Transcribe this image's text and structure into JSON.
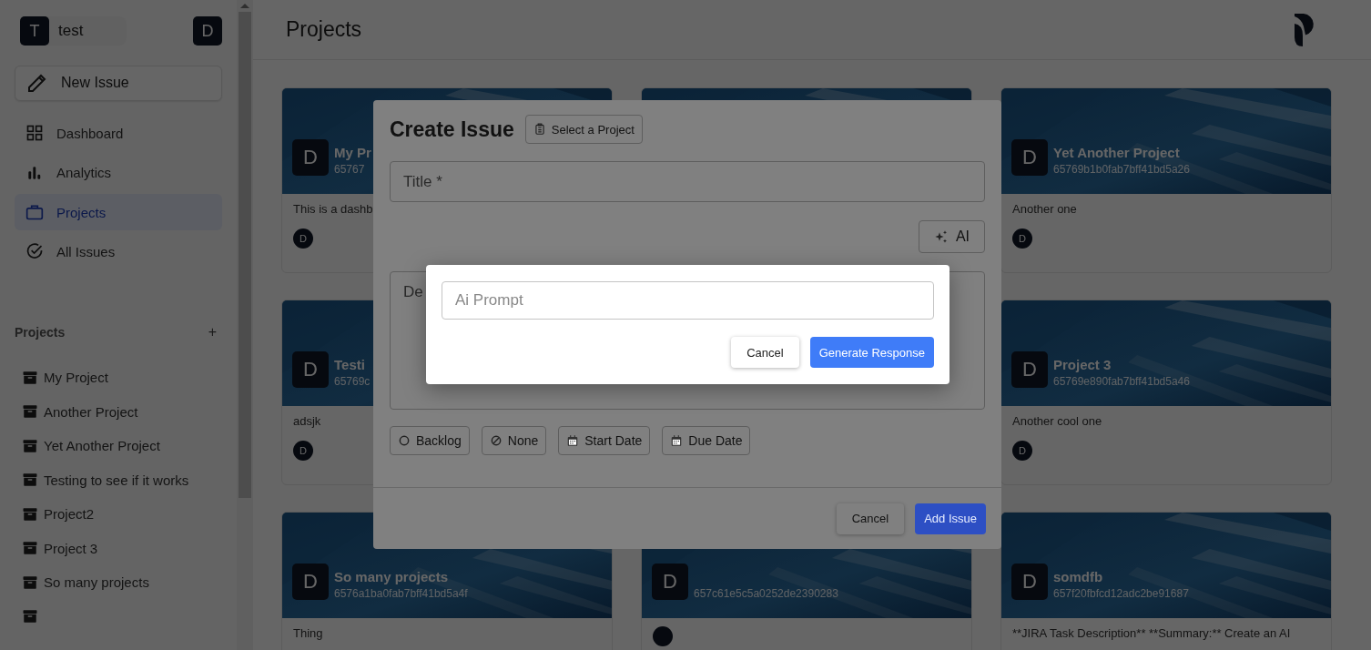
{
  "sidebar": {
    "workspace": {
      "initial": "T",
      "name": "test"
    },
    "user_avatar": "D",
    "new_issue": "New Issue",
    "nav": [
      {
        "label": "Dashboard",
        "selected": false
      },
      {
        "label": "Analytics",
        "selected": false
      },
      {
        "label": "Projects",
        "selected": true
      },
      {
        "label": "All Issues",
        "selected": false
      }
    ],
    "projects_heading": "Projects",
    "add_project": "+",
    "projects": [
      {
        "kind": "project",
        "label": "My Project"
      },
      {
        "kind": "project",
        "label": "Another Project"
      },
      {
        "kind": "project",
        "label": "Yet Another Project"
      },
      {
        "kind": "project",
        "label": "Testing to see if it works"
      },
      {
        "kind": "project",
        "label": "Project2"
      },
      {
        "kind": "project",
        "label": "Project 3"
      },
      {
        "kind": "project",
        "label": "So many projects"
      },
      {
        "kind": "project"
      }
    ]
  },
  "header": {
    "title": "Projects"
  },
  "card_columns": [
    [
      {
        "avatar": "D",
        "name": "My Pr",
        "id": "65767",
        "description": "This is a dashb",
        "member": "D"
      },
      {
        "avatar": "D",
        "name": "Testi",
        "id": "65769c",
        "description": "adsjk",
        "member": "D"
      },
      {
        "avatar": "D",
        "name": "So many projects",
        "id": "6576a1ba0fab7bff41bd5a4f",
        "description": "Thing"
      }
    ],
    [
      {},
      {
        "avatar": "D",
        "id": "657c61e5c5a0252de2390283",
        "has_member": true
      }
    ],
    [
      {
        "avatar": "D",
        "name": "Yet Another Project",
        "id": "65769b1b0fab7bff41bd5a26",
        "description": "Another one",
        "member": "D"
      },
      {
        "avatar": "D",
        "name": "Project 3",
        "id": "65769e890fab7bff41bd5a46",
        "description": "Another cool one",
        "member": "D"
      },
      {
        "avatar": "D",
        "name": "somdfb",
        "id": "657f20fbfcd12adc2be91687",
        "description": "**JIRA Task Description** **Summary:** Create an AI"
      }
    ]
  ],
  "create_issue": {
    "title": "Create Issue",
    "project_button": "Select a Project",
    "title_placeholder": "Title *",
    "ai_button": "AI",
    "description_placeholder": "De",
    "chips": [
      {
        "label": "Backlog"
      },
      {
        "label": "None"
      },
      {
        "label": "Start Date"
      },
      {
        "label": "Due Date"
      }
    ],
    "cancel": "Cancel",
    "submit": "Add Issue"
  },
  "ai_dialog": {
    "placeholder": "Ai Prompt",
    "cancel": "Cancel",
    "submit": "Generate Response"
  }
}
